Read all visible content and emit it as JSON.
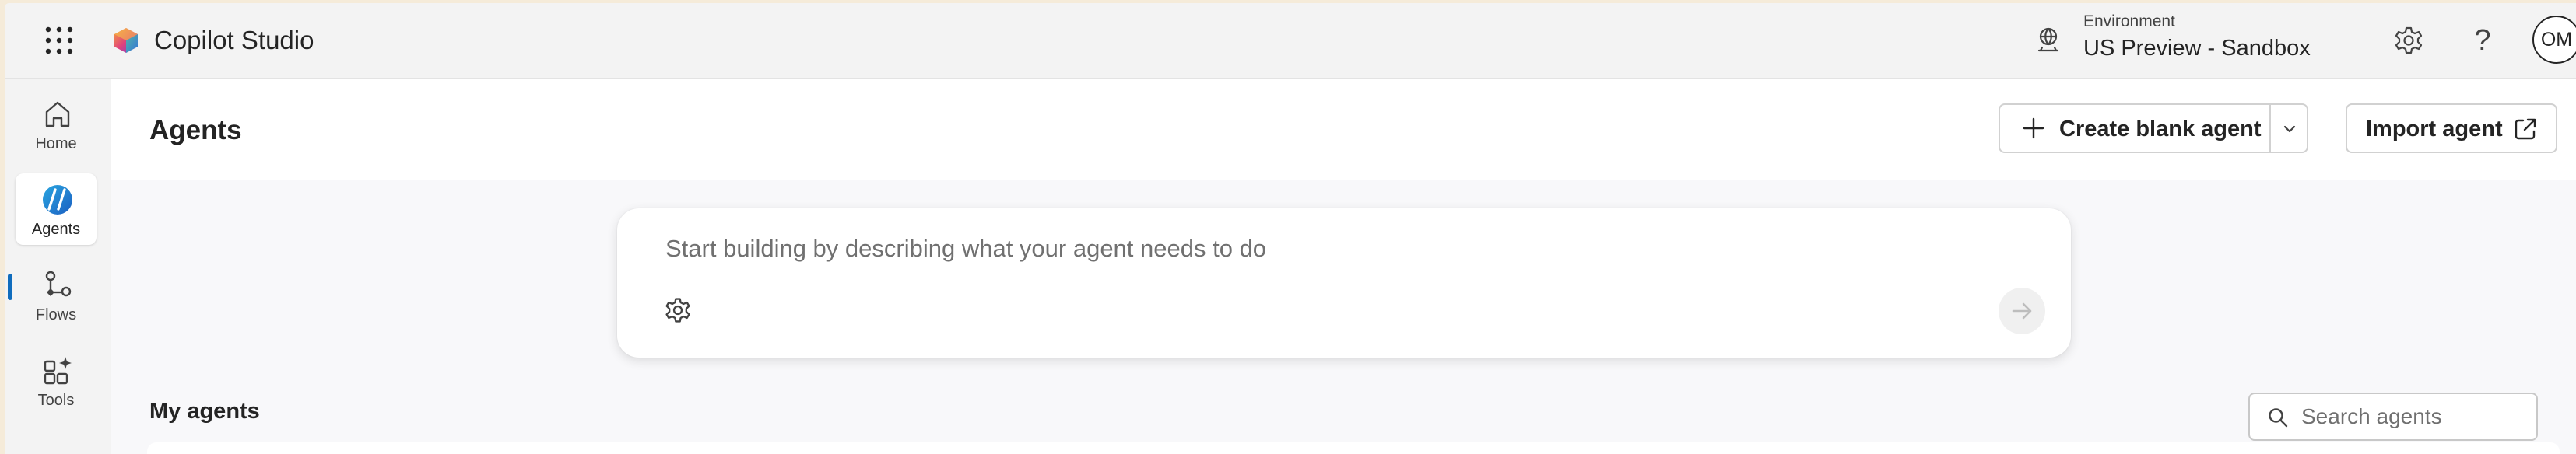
{
  "header": {
    "app_title": "Copilot Studio",
    "environment_label": "Environment",
    "environment_name": "US Preview - Sandbox",
    "help_glyph": "?",
    "avatar_initials": "OM",
    "icons": [
      "waffle-icon",
      "copilot-studio-logo",
      "environment-icon",
      "gear-icon",
      "help-icon"
    ]
  },
  "nav": {
    "items": [
      {
        "label": "Home",
        "icon": "home-icon"
      },
      {
        "label": "Agents",
        "icon": "agents-icon",
        "active": true
      },
      {
        "label": "Flows",
        "icon": "flows-icon"
      },
      {
        "label": "Tools",
        "icon": "tools-icon"
      }
    ]
  },
  "page": {
    "title": "Agents",
    "create_label": "Create blank agent",
    "import_label": "Import agent"
  },
  "prompt": {
    "placeholder": "Start building by describing what your agent needs to do",
    "value": ""
  },
  "my_agents": {
    "title": "My agents",
    "search_placeholder": "Search agents"
  },
  "colors": {
    "accent": "#0f6cbd",
    "background": "#f5f5f5",
    "outer_frame": "#f5ebd9"
  }
}
